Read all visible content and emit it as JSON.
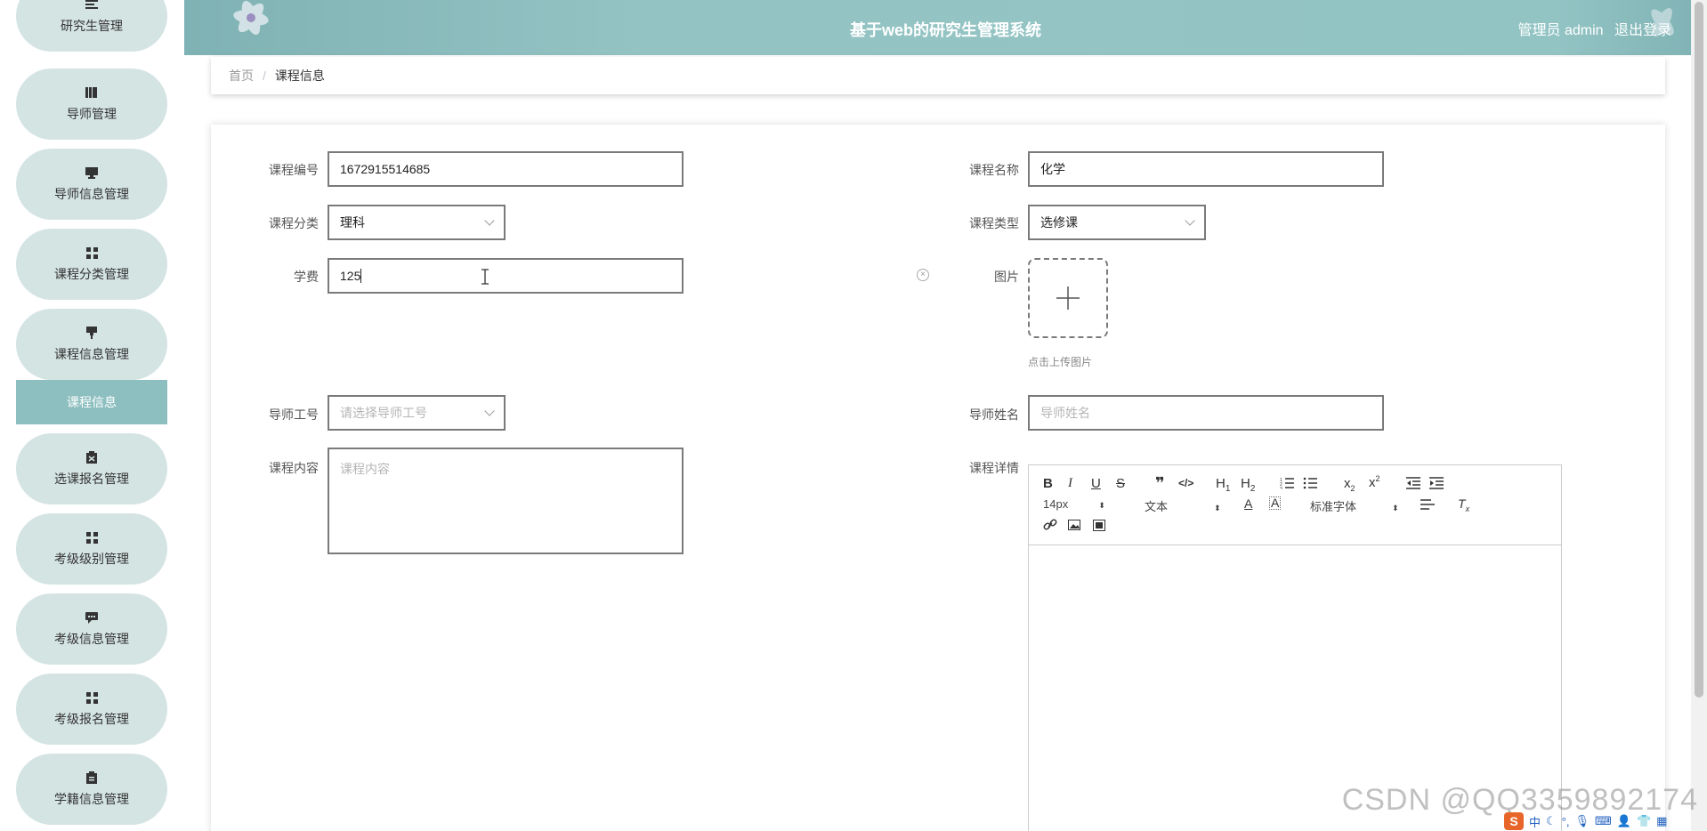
{
  "sidebar": {
    "items": [
      {
        "label": "研究生管理",
        "icon": "list-icon"
      },
      {
        "label": "导师管理",
        "icon": "book-icon"
      },
      {
        "label": "导师信息管理",
        "icon": "monitor-icon"
      },
      {
        "label": "课程分类管理",
        "icon": "grid-icon"
      },
      {
        "label": "课程信息管理",
        "icon": "flag-icon"
      },
      {
        "label": "选课报名管理",
        "icon": "clipboard-icon"
      },
      {
        "label": "考级级别管理",
        "icon": "grid-icon"
      },
      {
        "label": "考级信息管理",
        "icon": "comment-icon"
      },
      {
        "label": "考级报名管理",
        "icon": "grid-icon"
      },
      {
        "label": "学籍信息管理",
        "icon": "clipboard-icon"
      }
    ],
    "active_sub": "课程信息"
  },
  "header": {
    "title": "基于web的研究生管理系统",
    "role": "管理员 admin",
    "logout": "退出登录"
  },
  "breadcrumb": {
    "home": "首页",
    "separator": "/",
    "current": "课程信息"
  },
  "form": {
    "course_no": {
      "label": "课程编号",
      "value": "1672915514685"
    },
    "course_name": {
      "label": "课程名称",
      "value": "化学"
    },
    "course_category": {
      "label": "课程分类",
      "value": "理科"
    },
    "course_type": {
      "label": "课程类型",
      "value": "选修课"
    },
    "fee": {
      "label": "学费",
      "value": "125"
    },
    "image": {
      "label": "图片",
      "hint": "点击上传图片"
    },
    "tutor_id": {
      "label": "导师工号",
      "placeholder": "请选择导师工号"
    },
    "tutor_name": {
      "label": "导师姓名",
      "placeholder": "导师姓名"
    },
    "course_content": {
      "label": "课程内容",
      "placeholder": "课程内容"
    },
    "course_detail": {
      "label": "课程详情"
    }
  },
  "editor": {
    "font_size": "14px",
    "paragraph": "文本",
    "font_family": "标准字体"
  },
  "watermark": "CSDN @QQ3359892174",
  "tray": {
    "ime": "中"
  },
  "colors": {
    "header": "#93c4c4",
    "menu_bg": "#d4e4e3",
    "menu_active": "#8ebfc0"
  }
}
